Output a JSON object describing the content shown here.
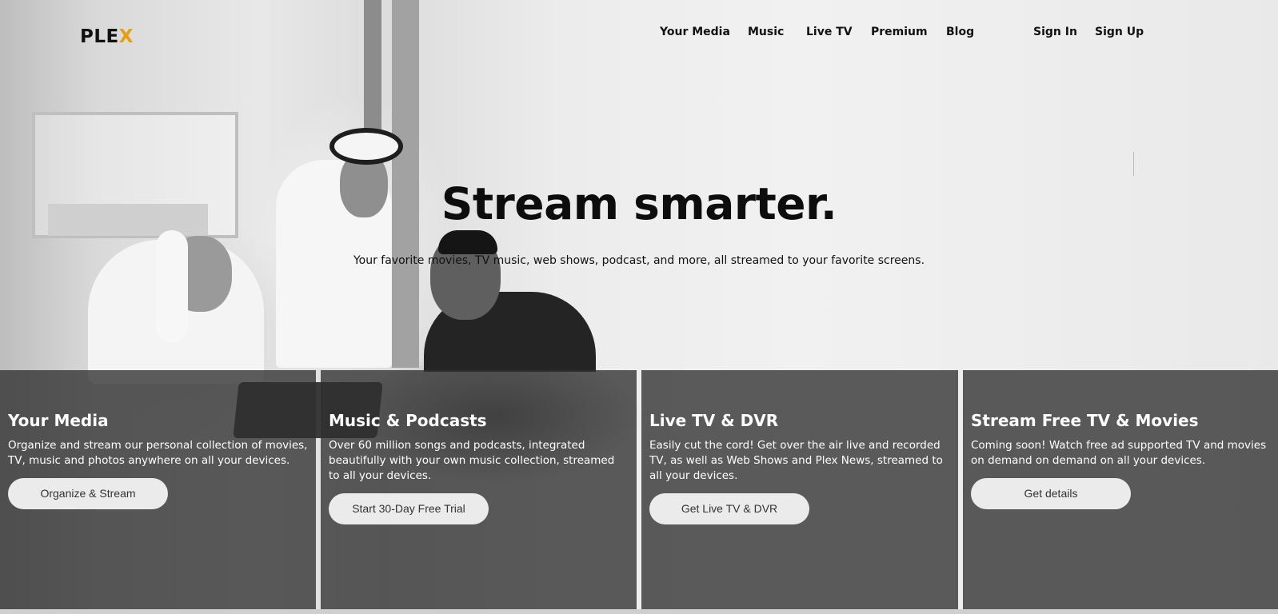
{
  "brand": {
    "logo_main": "PLE",
    "logo_accent": "X",
    "accent_color": "#e5a00d"
  },
  "nav": {
    "items": [
      "Your Media",
      "Music",
      "Live TV",
      "Premium",
      "Blog"
    ],
    "sign_in": "Sign In",
    "sign_up": "Sign Up"
  },
  "hero": {
    "title": "Stream smarter.",
    "subtitle": "Your favorite movies, TV music, web shows, podcast, and more, all streamed to your favorite screens."
  },
  "cards": [
    {
      "title": "Your Media",
      "text": "Organize and stream our personal collection of movies, TV, music and photos anywhere on all your devices.",
      "button": "Organize & Stream"
    },
    {
      "title": "Music & Podcasts",
      "text": "Over 60 million songs and podcasts, integrated beautifully with your own music collection, streamed to all your devices.",
      "button": "Start 30-Day Free Trial"
    },
    {
      "title": "Live TV & DVR",
      "text": "Easily cut the cord! Get over the air live and recorded TV, as well as Web Shows and Plex News, streamed to all your devices.",
      "button": "Get Live TV & DVR"
    },
    {
      "title": "Stream Free TV & Movies",
      "text": "Coming soon! Watch free ad supported TV and movies on demand on demand on all your devices.",
      "button": "Get details"
    }
  ],
  "colors": {
    "card_bg": "#303030",
    "button_bg": "#ebebeb"
  }
}
